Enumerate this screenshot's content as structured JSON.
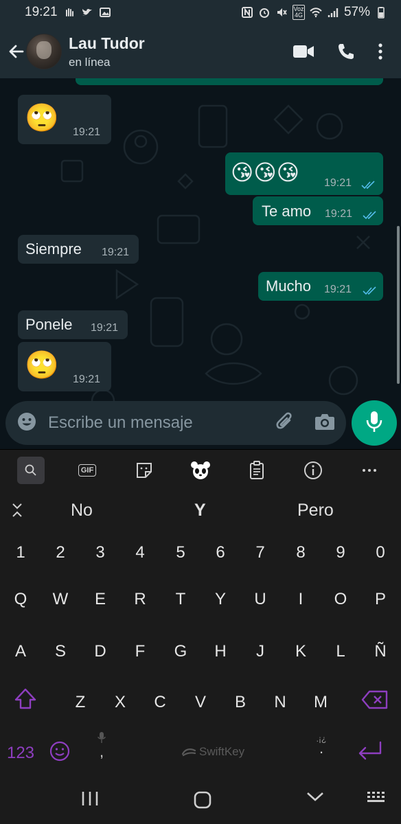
{
  "status_bar": {
    "time": "19:21",
    "battery": "57%",
    "network": "Voz 4G"
  },
  "header": {
    "contact_name": "Lau Tudor",
    "contact_status": "en línea"
  },
  "messages": [
    {
      "direction": "in",
      "content": "🙄",
      "time": "19:21"
    },
    {
      "direction": "out",
      "content": "😘😘😘",
      "time": "19:21"
    },
    {
      "direction": "out",
      "content": "Te amo",
      "time": "19:21"
    },
    {
      "direction": "in",
      "content": "Siempre",
      "time": "19:21"
    },
    {
      "direction": "out",
      "content": "Mucho",
      "time": "19:21"
    },
    {
      "direction": "in",
      "content": "Ponele",
      "time": "19:21"
    },
    {
      "direction": "in",
      "content": "🙄",
      "time": "19:21"
    }
  ],
  "input": {
    "placeholder": "Escribe un mensaje"
  },
  "keyboard": {
    "toolbar": {
      "gif_label": "GIF"
    },
    "suggestions": [
      "No",
      "Y",
      "Pero"
    ],
    "number_row": [
      "1",
      "2",
      "3",
      "4",
      "5",
      "6",
      "7",
      "8",
      "9",
      "0"
    ],
    "row1": [
      "Q",
      "W",
      "E",
      "R",
      "T",
      "Y",
      "U",
      "I",
      "O",
      "P"
    ],
    "row2": [
      "A",
      "S",
      "D",
      "F",
      "G",
      "H",
      "J",
      "K",
      "L",
      "Ñ"
    ],
    "row3": [
      "Z",
      "X",
      "C",
      "V",
      "B",
      "N",
      "M"
    ],
    "numbers_key": "123",
    "comma_key": ",",
    "period_key": ".",
    "punct_hint": ".¡¿",
    "brand": "SwiftKey"
  },
  "colors": {
    "header_bg": "#1f2c33",
    "chat_bg": "#0b141a",
    "incoming_bubble": "#1f2c33",
    "outgoing_bubble": "#005c4b",
    "accent_green": "#00a884",
    "read_ticks": "#53bdeb",
    "keyboard_accent": "#8e3ec0"
  }
}
